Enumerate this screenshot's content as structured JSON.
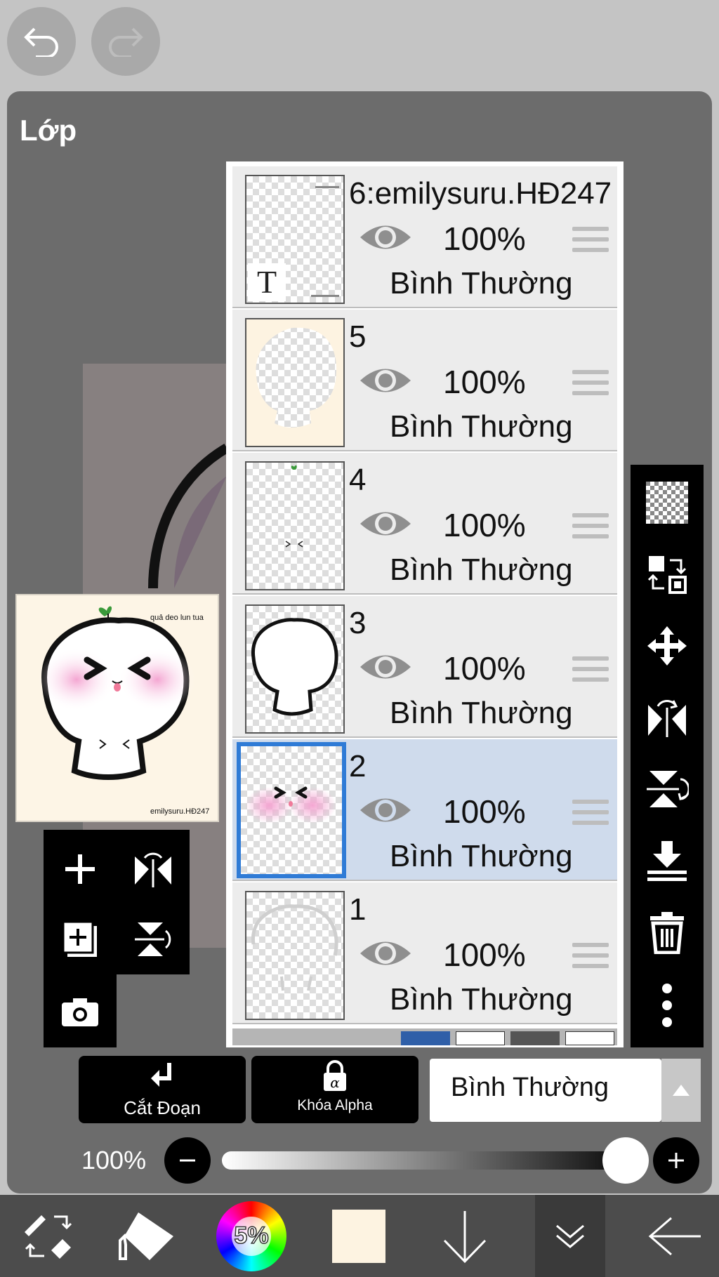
{
  "panel": {
    "title": "Lớp"
  },
  "preview": {
    "caption_top": "quả deo lun tua",
    "caption_bottom": "emilysuru.HĐ247"
  },
  "layers": [
    {
      "name": "6:emilysuru.HĐ247",
      "opacity": "100%",
      "blend": "Bình Thường",
      "visible": true,
      "selected": false,
      "thumb_letter": "T"
    },
    {
      "name": "5",
      "opacity": "100%",
      "blend": "Bình Thường",
      "visible": true,
      "selected": false
    },
    {
      "name": "4",
      "opacity": "100%",
      "blend": "Bình Thường",
      "visible": true,
      "selected": false
    },
    {
      "name": "3",
      "opacity": "100%",
      "blend": "Bình Thường",
      "visible": true,
      "selected": false
    },
    {
      "name": "2",
      "opacity": "100%",
      "blend": "Bình Thường",
      "visible": true,
      "selected": true
    },
    {
      "name": "1",
      "opacity": "100%",
      "blend": "Bình Thường",
      "visible": true,
      "selected": false
    }
  ],
  "controls": {
    "clip_label": "Cắt Đoạn",
    "alpha_lock_label": "Khóa Alpha",
    "blend_mode": "Bình Thường",
    "opacity_label": "100%",
    "opacity_value": 1.0
  },
  "bottom_bar": {
    "color_wheel_label": "5%",
    "current_color": "#fdf3e1"
  },
  "colors": {
    "selection_blue": "#2f7bd6",
    "selected_row": "#cfdbec",
    "panel_bg": "#6c6c6c"
  },
  "icons": {
    "undo": "undo-icon",
    "redo": "redo-icon",
    "add_layer": "plus-icon",
    "duplicate": "duplicate-layer-icon",
    "camera": "camera-icon",
    "flip_h": "flip-horizontal-icon",
    "flip_v": "flip-vertical-icon",
    "transparent": "checkerboard-icon",
    "swap": "swap-layer-icon",
    "move": "move-icon",
    "merge_down": "merge-down-icon",
    "delete": "trash-icon",
    "more": "more-vertical-icon"
  }
}
